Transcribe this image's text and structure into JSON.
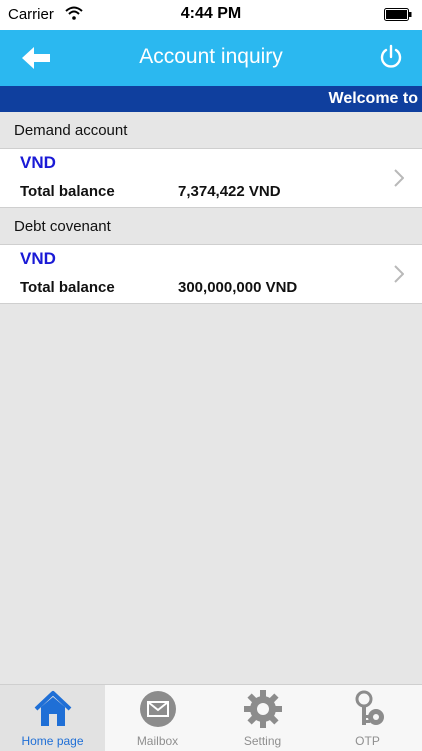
{
  "status_bar": {
    "carrier": "Carrier",
    "time": "4:44 PM"
  },
  "nav_bar": {
    "title": "Account inquiry",
    "back_icon": "back-arrow-icon",
    "power_icon": "power-icon"
  },
  "marquee": {
    "text": "Welcome to"
  },
  "sections": [
    {
      "header": "Demand account",
      "accounts": [
        {
          "currency": "VND",
          "balance_label": "Total balance",
          "balance_value": "7,374,422 VND"
        }
      ]
    },
    {
      "header": "Debt covenant",
      "accounts": [
        {
          "currency": "VND",
          "balance_label": "Total balance",
          "balance_value": "300,000,000 VND"
        }
      ]
    }
  ],
  "tab_bar": {
    "items": [
      {
        "label": "Home page",
        "icon": "home-icon",
        "active": true
      },
      {
        "label": "Mailbox",
        "icon": "mail-icon",
        "active": false
      },
      {
        "label": "Setting",
        "icon": "gear-icon",
        "active": false
      },
      {
        "label": "OTP",
        "icon": "key-icon",
        "active": false
      }
    ]
  },
  "colors": {
    "nav_bar": "#2bb8f0",
    "marquee": "#0f3f9e",
    "currency_text": "#1a1ad6",
    "active_tab": "#1f6fd6"
  }
}
